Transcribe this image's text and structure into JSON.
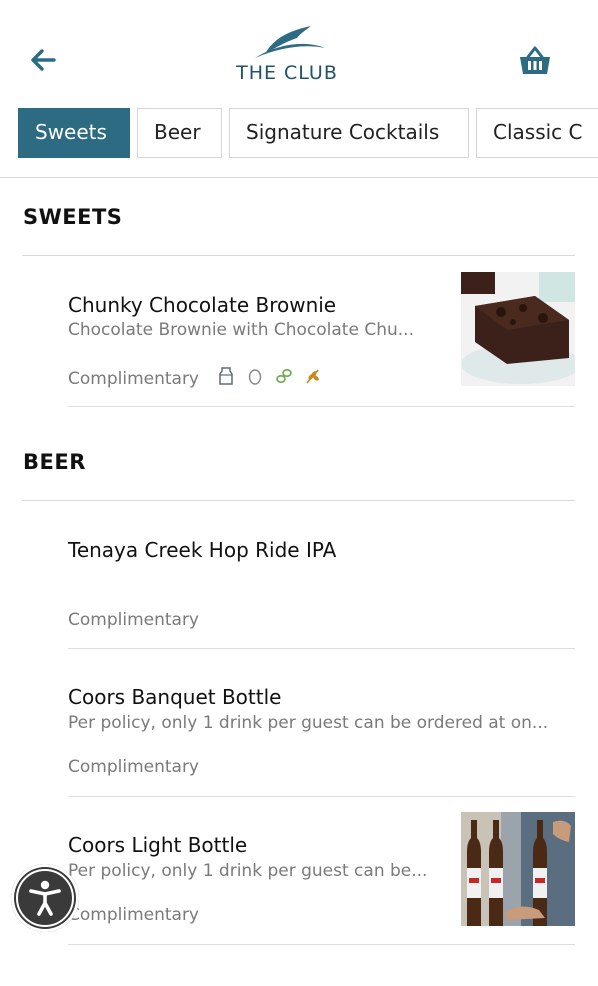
{
  "header": {
    "logo_text": "THE CLUB",
    "back_icon": "arrow-left-icon",
    "cart_icon": "basket-icon",
    "brand_color": "#22526b"
  },
  "tabs": [
    {
      "label": "Sweets",
      "active": true
    },
    {
      "label": "Beer",
      "active": false
    },
    {
      "label": "Signature Cocktails",
      "active": false
    },
    {
      "label": "Classic C",
      "active": false
    }
  ],
  "sections": {
    "sweets": {
      "title": "SWEETS",
      "items": [
        {
          "name": "Chunky Chocolate Brownie",
          "description": "Chocolate Brownie with Chocolate Chu...",
          "price": "Complimentary",
          "diet_icons": [
            "milk-icon",
            "egg-icon",
            "nut-icon",
            "wheat-icon"
          ]
        }
      ]
    },
    "beer": {
      "title": "BEER",
      "items": [
        {
          "name": "Tenaya Creek Hop Ride IPA",
          "description": "",
          "price": "Complimentary"
        },
        {
          "name": "Coors Banquet Bottle",
          "description": "Per policy, only 1 drink per guest can be ordered at on...",
          "price": "Complimentary"
        },
        {
          "name": "Coors Light Bottle",
          "description": "Per policy, only 1 drink per guest can be...",
          "price": "Complimentary"
        }
      ]
    }
  },
  "colors": {
    "accent": "#2c6b82",
    "muted_text": "#7a7a7a",
    "divider": "#d9d9d9"
  },
  "accessibility_icon": "accessibility-icon"
}
